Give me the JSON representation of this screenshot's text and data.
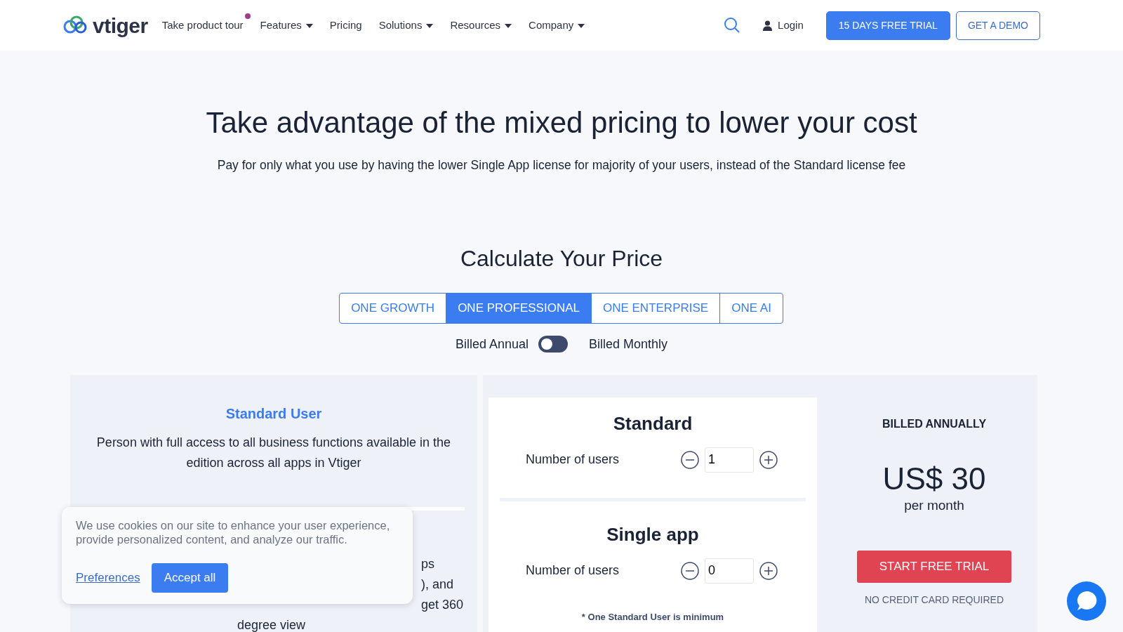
{
  "nav": {
    "brand": "vtiger",
    "items": [
      {
        "label": "Take product tour",
        "kind": "dot"
      },
      {
        "label": "Features",
        "kind": "dropdown"
      },
      {
        "label": "Pricing",
        "kind": "plain"
      },
      {
        "label": "Solutions",
        "kind": "dropdown"
      },
      {
        "label": "Resources",
        "kind": "dropdown"
      },
      {
        "label": "Company",
        "kind": "dropdown"
      }
    ],
    "login": "Login",
    "trial_button": "15 DAYS FREE TRIAL",
    "demo_button": "GET A DEMO"
  },
  "hero": {
    "title": "Take advantage of the mixed pricing to lower your cost",
    "subtitle": "Pay for only what you use by having the lower Single App license for majority of your users, instead of the Standard license fee"
  },
  "calculator": {
    "title": "Calculate Your Price",
    "tabs": [
      {
        "label": "ONE GROWTH",
        "selected": false
      },
      {
        "label": "ONE PROFESSIONAL",
        "selected": true
      },
      {
        "label": "ONE ENTERPRISE",
        "selected": false
      },
      {
        "label": "ONE AI",
        "selected": false
      }
    ],
    "billing": {
      "left_label": "Billed Annual",
      "right_label": "Billed Monthly",
      "on": false
    },
    "user_types": [
      {
        "title": "Standard User",
        "description": "Person with full access to all business functions available in the edition across all apps in Vtiger"
      },
      {
        "visible_lines": [
          "ps",
          "), and",
          "get 360",
          "degree view"
        ]
      }
    ],
    "licenses": [
      {
        "title": "Standard",
        "label": "Number of users",
        "value": "1"
      },
      {
        "title": "Single app",
        "label": "Number of users",
        "value": "0"
      }
    ],
    "note": "* One Standard User is minimum",
    "summary": {
      "heading": "BILLED ANNUALLY",
      "price": "US$ 30",
      "period": "per month",
      "button": "START FREE TRIAL",
      "footnote": "NO CREDIT CARD REQUIRED"
    }
  },
  "cookie_banner": {
    "text": "We use cookies on our site to enhance your user experience, provide personalized content, and analyze our traffic.",
    "preferences": "Preferences",
    "accept": "Accept all"
  }
}
